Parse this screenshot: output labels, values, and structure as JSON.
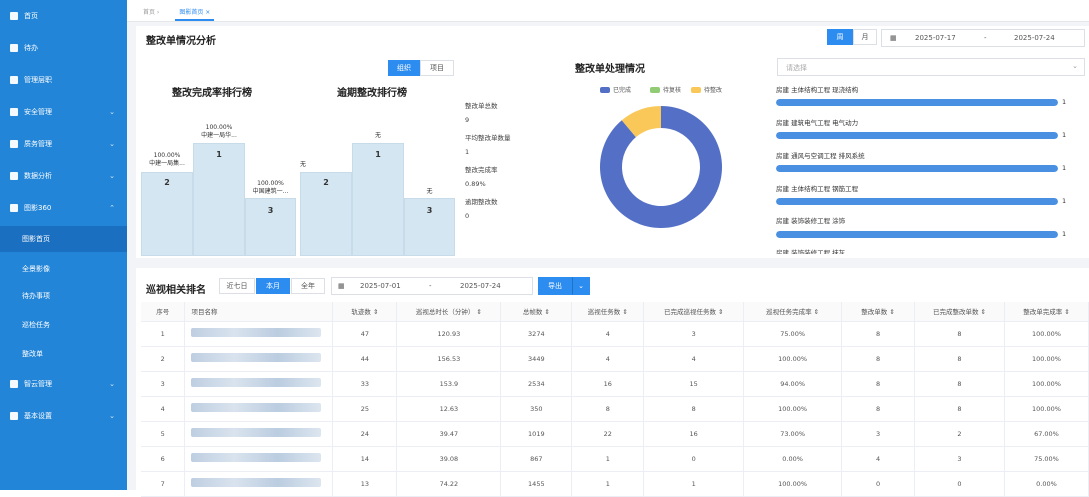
{
  "sidebar": {
    "items": [
      {
        "label": "首页",
        "icon": "home-icon"
      },
      {
        "label": "待办",
        "icon": "todo-icon"
      },
      {
        "label": "管理层职",
        "icon": "org-icon"
      },
      {
        "label": "安全管理",
        "icon": "safety-icon"
      },
      {
        "label": "质务管理",
        "icon": "quality-icon"
      },
      {
        "label": "数据分析",
        "icon": "chart-icon"
      },
      {
        "label": "图影360",
        "icon": "doc-icon"
      },
      {
        "label": "图影首页",
        "icon": ""
      },
      {
        "label": "全景影像",
        "icon": ""
      },
      {
        "label": "待办事项",
        "icon": ""
      },
      {
        "label": "巡检任务",
        "icon": ""
      },
      {
        "label": "整改单",
        "icon": ""
      },
      {
        "label": "智云管理",
        "icon": "cloud-icon"
      },
      {
        "label": "基本设置",
        "icon": "settings-icon"
      }
    ]
  },
  "tabs": [
    "首页",
    "图影首页"
  ],
  "summary": {
    "title": "整改单情况分析",
    "toggle_day": "周",
    "toggle_month": "月",
    "date_start": "2025-07-17",
    "date_sep": "-",
    "date_end": "2025-07-24",
    "seg_org": "组织",
    "seg_project": "项目",
    "rank1_title": "整改完成率排行榜",
    "rank2_title": "逾期整改排行榜",
    "donut_title": "整改单处理情况",
    "select_placeholder": "请选择",
    "stats": [
      {
        "label": "整改单总数",
        "value": "9"
      },
      {
        "label": "平均整改单数量",
        "value": "1"
      },
      {
        "label": "整改完成率",
        "value": "0.89%"
      },
      {
        "label": "逾期整改数",
        "value": "0"
      }
    ],
    "rank1": [
      {
        "pct": "100.00%",
        "name": "中建一局集...",
        "rank": "2"
      },
      {
        "pct": "100.00%",
        "name": "中建一局华...",
        "rank": "1"
      },
      {
        "pct": "100.00%",
        "name": "中国建筑一...",
        "rank": "3"
      }
    ],
    "rank2": [
      {
        "pct": "无",
        "rank": "2"
      },
      {
        "pct": "无",
        "rank": "1"
      },
      {
        "pct": "无",
        "rank": "3"
      }
    ],
    "legend": [
      {
        "label": "已完成",
        "color": "#5470c6"
      },
      {
        "label": "待复核",
        "color": "#91cc75"
      },
      {
        "label": "待整改",
        "color": "#fac858"
      }
    ],
    "categories": [
      {
        "label": "房建 主体结构工程 现浇结构",
        "value": "1"
      },
      {
        "label": "房建 建筑电气工程 电气动力",
        "value": "1"
      },
      {
        "label": "房建 通风与空调工程 排风系统",
        "value": "1"
      },
      {
        "label": "房建 主体结构工程 钢筋工程",
        "value": "1"
      },
      {
        "label": "房建 装饰装修工程 涂饰",
        "value": "1"
      },
      {
        "label": "房建 装饰装修工程 抹灰",
        "value": ""
      }
    ]
  },
  "patrol": {
    "title": "巡视相关排名",
    "range_7": "近七日",
    "range_month": "本月",
    "range_year": "全年",
    "date_start": "2025-07-01",
    "date_sep": "-",
    "date_end": "2025-07-24",
    "export_label": "导出",
    "columns": [
      "序号",
      "项目名称",
      "轨迹数 ⇕",
      "巡视总时长（分钟） ⇕",
      "总帧数 ⇕",
      "巡视任务数 ⇕",
      "已完成巡视任务数 ⇕",
      "巡视任务完成率 ⇕",
      "整改单数 ⇕",
      "已完成整改单数 ⇕",
      "整改单完成率 ⇕"
    ],
    "rows": [
      [
        "1",
        "47",
        "120.93",
        "3274",
        "4",
        "3",
        "75.00%",
        "8",
        "8",
        "100.00%"
      ],
      [
        "2",
        "44",
        "156.53",
        "3449",
        "4",
        "4",
        "100.00%",
        "8",
        "8",
        "100.00%"
      ],
      [
        "3",
        "33",
        "153.9",
        "2534",
        "16",
        "15",
        "94.00%",
        "8",
        "8",
        "100.00%"
      ],
      [
        "4",
        "25",
        "12.63",
        "350",
        "8",
        "8",
        "100.00%",
        "8",
        "8",
        "100.00%"
      ],
      [
        "5",
        "24",
        "39.47",
        "1019",
        "22",
        "16",
        "73.00%",
        "3",
        "2",
        "67.00%"
      ],
      [
        "6",
        "14",
        "39.08",
        "867",
        "1",
        "0",
        "0.00%",
        "4",
        "3",
        "75.00%"
      ],
      [
        "7",
        "13",
        "74.22",
        "1455",
        "1",
        "1",
        "100.00%",
        "0",
        "0",
        "0.00%"
      ]
    ]
  },
  "donut": {
    "completed": 8,
    "review": 0,
    "pending": 1
  }
}
